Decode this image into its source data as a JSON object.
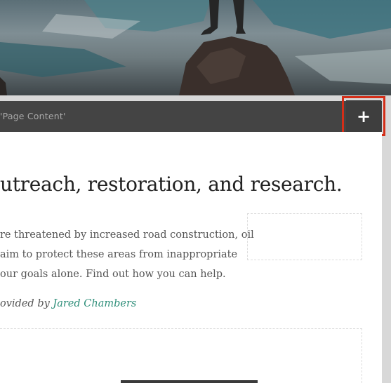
{
  "toolbar": {
    "section_label": "'Page Content'",
    "add_icon": "plus-icon",
    "add_symbol": "+"
  },
  "content": {
    "heading": "utreach, restoration, and research.",
    "body_lines": [
      "re threatened by increased road construction, oil",
      "aim to protect these areas from inappropriate",
      "our goals alone. Find out how you can help."
    ],
    "credit_prefix": "ovided by ",
    "credit_name": "Jared Chambers"
  },
  "colors": {
    "toolbar": "#444444",
    "highlight": "#d42e18",
    "link": "#2f8f7a"
  }
}
